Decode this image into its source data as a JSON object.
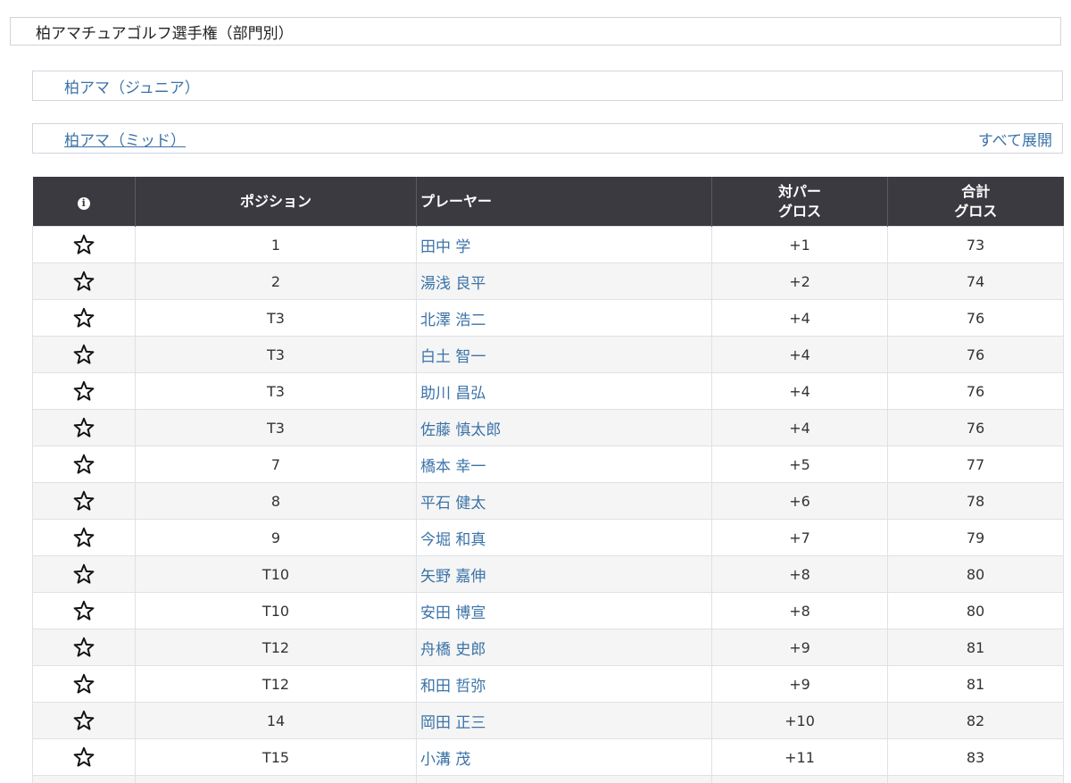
{
  "page_title": "柏アマチュアゴルフ選手権（部門別）",
  "divisions": {
    "junior_label": "柏アマ（ジュニア）",
    "mid_label": "柏アマ（ミッド）",
    "expand_all": "すべて展開"
  },
  "table": {
    "headers": {
      "info": "i",
      "position": "ポジション",
      "player": "プレーヤー",
      "to_par_line1": "対パー",
      "to_par_line2": "グロス",
      "total_line1": "合計",
      "total_line2": "グロス"
    },
    "rows": [
      {
        "pos": "1",
        "name": "田中 学",
        "to_par": "+1",
        "total": "73"
      },
      {
        "pos": "2",
        "name": "湯浅 良平",
        "to_par": "+2",
        "total": "74"
      },
      {
        "pos": "T3",
        "name": "北澤 浩二",
        "to_par": "+4",
        "total": "76"
      },
      {
        "pos": "T3",
        "name": "白土 智一",
        "to_par": "+4",
        "total": "76"
      },
      {
        "pos": "T3",
        "name": "助川 昌弘",
        "to_par": "+4",
        "total": "76"
      },
      {
        "pos": "T3",
        "name": "佐藤 慎太郎",
        "to_par": "+4",
        "total": "76"
      },
      {
        "pos": "7",
        "name": "橋本 幸一",
        "to_par": "+5",
        "total": "77"
      },
      {
        "pos": "8",
        "name": "平石 健太",
        "to_par": "+6",
        "total": "78"
      },
      {
        "pos": "9",
        "name": "今堀 和真",
        "to_par": "+7",
        "total": "79"
      },
      {
        "pos": "T10",
        "name": "矢野 嘉伸",
        "to_par": "+8",
        "total": "80"
      },
      {
        "pos": "T10",
        "name": "安田 博宣",
        "to_par": "+8",
        "total": "80"
      },
      {
        "pos": "T12",
        "name": "舟橋 史郎",
        "to_par": "+9",
        "total": "81"
      },
      {
        "pos": "T12",
        "name": "和田 哲弥",
        "to_par": "+9",
        "total": "81"
      },
      {
        "pos": "14",
        "name": "岡田 正三",
        "to_par": "+10",
        "total": "82"
      },
      {
        "pos": "T15",
        "name": "小溝 茂",
        "to_par": "+11",
        "total": "83"
      },
      {
        "pos": "",
        "name": "",
        "to_par": "",
        "total": ""
      }
    ]
  },
  "icons": {
    "favorite": "star-outline-icon",
    "info": "info-icon"
  },
  "colors": {
    "link": "#3b73a8",
    "header_bg": "#3a3a40",
    "alt_row": "#f5f5f5"
  }
}
